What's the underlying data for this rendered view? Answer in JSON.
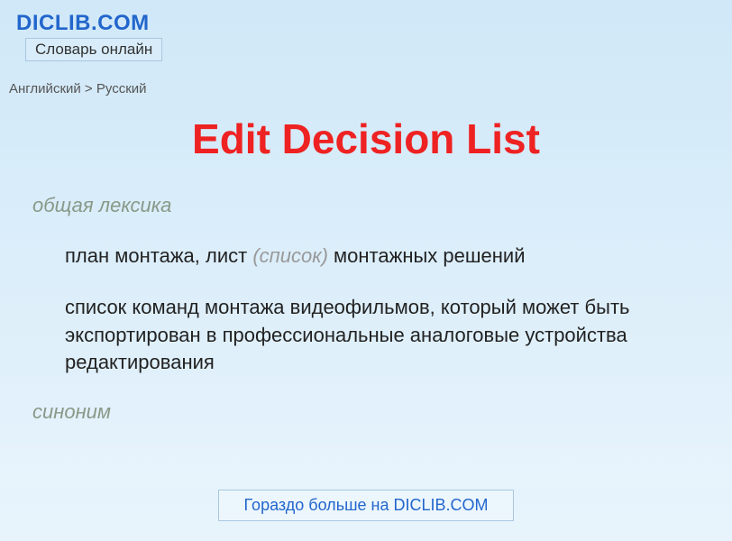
{
  "header": {
    "site_title": "DICLIB.COM",
    "tagline": "Словарь онлайн"
  },
  "breadcrumb": "Английский > Русский",
  "entry": {
    "title": "Edit Decision List",
    "category": "общая лексика",
    "definition1_prefix": "план монтажа, лист ",
    "definition1_italic": "(список)",
    "definition1_suffix": " монтажных решений",
    "definition2": "список команд монтажа видеофильмов, который может быть экспортирован в профессиональные аналоговые устройства редактирования",
    "synonym_label": "синоним"
  },
  "footer": {
    "link_text": "Гораздо больше на DICLIB.COM"
  }
}
